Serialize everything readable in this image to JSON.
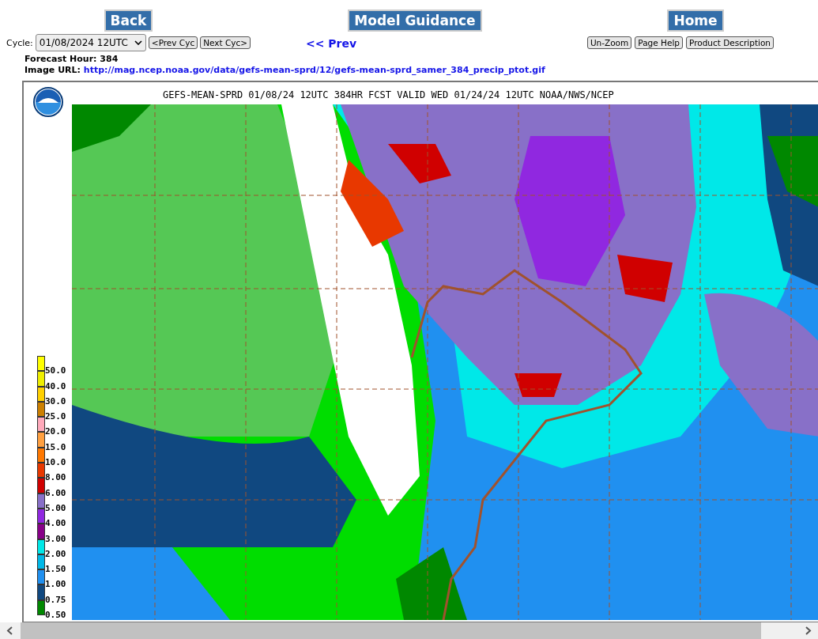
{
  "nav_buttons": [
    "Back",
    "Model Guidance",
    "Home"
  ],
  "cycle": {
    "label": "Cycle:",
    "value": "01/08/2024 12UTC",
    "prev": "<Prev Cyc",
    "next": "Next Cyc>"
  },
  "prev_link": "<< Prev",
  "tool_buttons": [
    "Un-Zoom",
    "Page Help",
    "Product Description"
  ],
  "forecast_hour": {
    "label": "Forecast Hour:",
    "value": "384"
  },
  "image_url": {
    "label": "Image URL:",
    "link": "http://mag.ncep.noaa.gov/data/gefs-mean-sprd/12/gefs-mean-sprd_samer_384_precip_ptot.gif"
  },
  "map": {
    "title": "GEFS-MEAN-SPRD 01/08/24 12UTC 384HR FCST VALID WED 01/24/24 12UTC NOAA/NWS/NCEP",
    "legend": [
      {
        "label": "50.0",
        "color": "#ffff00"
      },
      {
        "label": "40.0",
        "color": "#eeee00"
      },
      {
        "label": "30.0",
        "color": "#ffd000"
      },
      {
        "label": "25.0",
        "color": "#cc8000"
      },
      {
        "label": "20.0",
        "color": "#ffaabb"
      },
      {
        "label": "15.0",
        "color": "#ffa040"
      },
      {
        "label": "10.0",
        "color": "#ff7800"
      },
      {
        "label": "8.00",
        "color": "#e83800"
      },
      {
        "label": "6.00",
        "color": "#d00000"
      },
      {
        "label": "5.00",
        "color": "#8870c8"
      },
      {
        "label": "4.00",
        "color": "#9028e0"
      },
      {
        "label": "3.00",
        "color": "#880088"
      },
      {
        "label": "2.00",
        "color": "#00e8e8"
      },
      {
        "label": "1.50",
        "color": "#00b8e8"
      },
      {
        "label": "1.00",
        "color": "#2090f0"
      },
      {
        "label": "0.75",
        "color": "#104880"
      },
      {
        "label": "0.50",
        "color": "#008800"
      }
    ]
  }
}
